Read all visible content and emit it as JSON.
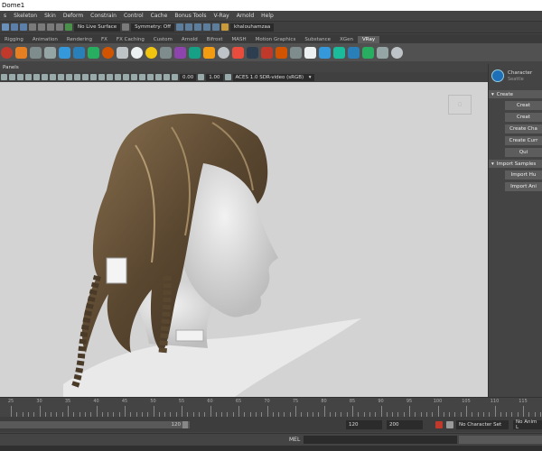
{
  "window": {
    "title": "Dome1"
  },
  "menu": [
    "s",
    "Skeleton",
    "Skin",
    "Deform",
    "Constrain",
    "Control",
    "Cache",
    "Bonus Tools",
    "V-Ray",
    "Arnold",
    "Help"
  ],
  "status_line": {
    "live_surface": "No Live Surface",
    "symmetry": "Symmetry: Off",
    "user": "khalouhamzaa"
  },
  "shelf_tabs": [
    "Rigging",
    "Animation",
    "Rendering",
    "FX",
    "FX Caching",
    "Custom",
    "Arnold",
    "Bifrost",
    "MASH",
    "Motion Graphics",
    "Substance",
    "XGen",
    "VRay"
  ],
  "active_shelf_tab": "VRay",
  "panel_menu": {
    "label": "Panels"
  },
  "viewport_toolbar": {
    "exposure": "0.00",
    "gamma": "1.00",
    "color_space": "ACES 1.0 SDR-video (sRGB)"
  },
  "side_panel": {
    "title": "Character",
    "subtitle": "Seattle",
    "create_section": "Create",
    "create_buttons": [
      "Creat",
      "Creat",
      "Create Cha",
      "Create Curr",
      "Qui"
    ],
    "import_section": "Import Samples",
    "import_buttons": [
      "Import Hu",
      "Import Ani"
    ]
  },
  "timeline": {
    "ticks": [
      "25",
      "30",
      "35",
      "40",
      "45",
      "50",
      "55",
      "60",
      "65",
      "70",
      "75",
      "80",
      "85",
      "90",
      "95",
      "100",
      "105",
      "110",
      "115"
    ]
  },
  "range": {
    "current_end": "120",
    "end": "120",
    "anim_end": "200",
    "character_set": "No Character Set",
    "anim_layer": "No Anim L"
  },
  "command_line": {
    "label": "MEL"
  },
  "colors": {
    "viewport_bg": "#d3d3d3",
    "ui_bg": "#444444",
    "accent": "#1d6fb8"
  }
}
